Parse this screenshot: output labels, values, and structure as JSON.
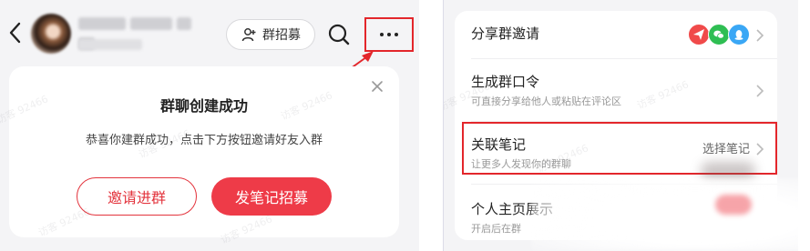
{
  "left_panel": {
    "recruit_button_label": "群招募",
    "card": {
      "title": "群聊创建成功",
      "description": "恭喜你建群成功，点击下方按钮邀请好友入群",
      "invite_button": "邀请进群",
      "post_button": "发笔记招募"
    },
    "watermark": "访客 92466"
  },
  "right_panel": {
    "rows": [
      {
        "title": "分享群邀请",
        "subtitle": "",
        "value": "",
        "icons": [
          "paper-plane-icon",
          "wechat-icon",
          "qq-icon"
        ]
      },
      {
        "title": "生成群口令",
        "subtitle": "可直接分享给他人或粘贴在评论区",
        "value": ""
      },
      {
        "title": "关联笔记",
        "subtitle": "让更多人发现你的群聊",
        "value": "选择笔记"
      },
      {
        "title": "个人主页展示",
        "subtitle": "开启后在群",
        "value": ""
      }
    ],
    "watermark": "访客 92466"
  },
  "colors": {
    "accent_red": "#ee3b48",
    "highlight_red": "#e3262b",
    "share_red": "#f04a4a",
    "wechat_green": "#2fbe53",
    "qq_blue": "#3aa7f5"
  }
}
